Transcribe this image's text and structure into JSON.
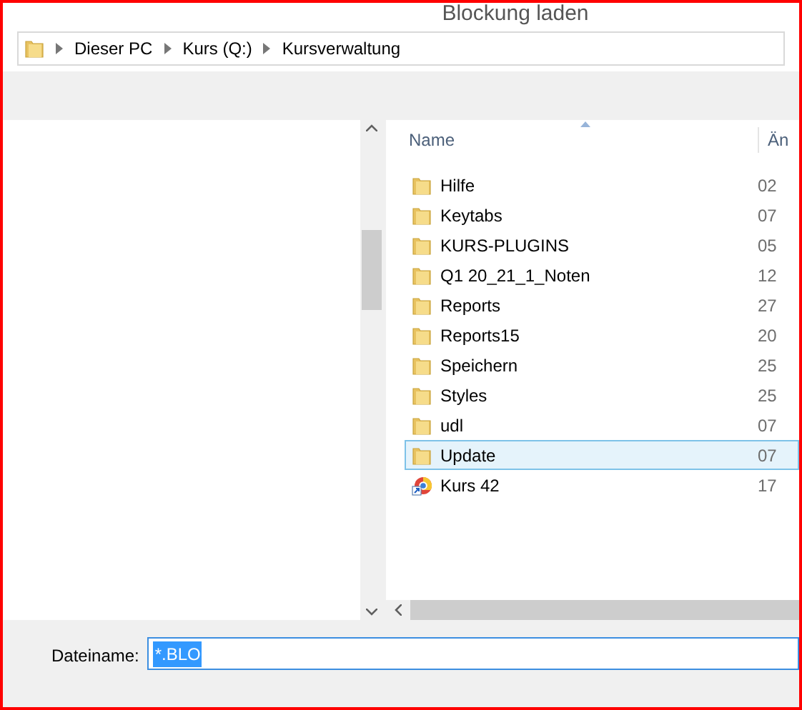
{
  "window": {
    "title": "Blockung laden"
  },
  "breadcrumb": [
    "Dieser PC",
    "Kurs (Q:)",
    "Kursverwaltung"
  ],
  "file_list": {
    "columns": [
      "Name",
      "Än"
    ],
    "rows": [
      {
        "kind": "folder",
        "name": "Hilfe",
        "column_2": "02",
        "selected": false
      },
      {
        "kind": "folder",
        "name": "Keytabs",
        "column_2": "07",
        "selected": false
      },
      {
        "kind": "folder",
        "name": "KURS-PLUGINS",
        "column_2": "05",
        "selected": false
      },
      {
        "kind": "folder",
        "name": "Q1 20_21_1_Noten",
        "column_2": "12",
        "selected": false
      },
      {
        "kind": "folder",
        "name": "Reports",
        "column_2": "27",
        "selected": false
      },
      {
        "kind": "folder",
        "name": "Reports15",
        "column_2": "20",
        "selected": false
      },
      {
        "kind": "folder",
        "name": "Speichern",
        "column_2": "25",
        "selected": false
      },
      {
        "kind": "folder",
        "name": "Styles",
        "column_2": "25",
        "selected": false
      },
      {
        "kind": "folder",
        "name": "udl",
        "column_2": "07",
        "selected": false
      },
      {
        "kind": "folder",
        "name": "Update",
        "column_2": "07",
        "selected": true
      },
      {
        "kind": "shortcut",
        "name": "Kurs 42",
        "column_2": "17",
        "selected": false
      }
    ]
  },
  "filename": {
    "label": "Dateiname:",
    "value": "*.BLO"
  }
}
